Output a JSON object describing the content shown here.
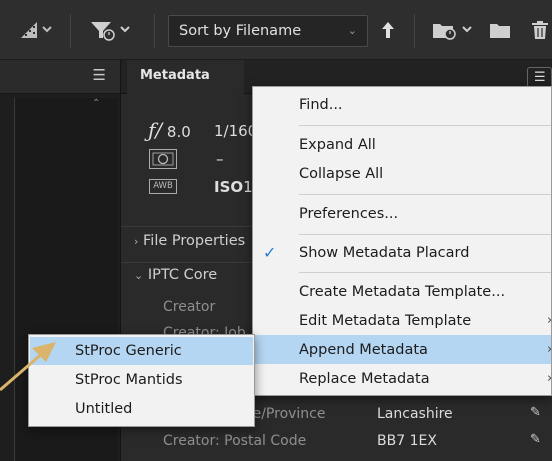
{
  "toolbar": {
    "sort_label": "Sort by Filename"
  },
  "panel": {
    "tab_label": "Metadata"
  },
  "placard": {
    "aperture_symbol": "ƒ/",
    "aperture": "8.0",
    "shutter": "1/160",
    "metering": "–",
    "wb_icon": "AWB",
    "iso_label": "ISO",
    "iso_value": "1"
  },
  "sections": {
    "file_properties": "File Properties",
    "iptc_core": "IPTC Core"
  },
  "fields": {
    "creator_label": "Creator",
    "creator_job_label": "Creator: Job",
    "state_label": "Creator: State/Province",
    "state_value": "Lancashire",
    "postal_label": "Creator: Postal Code",
    "postal_value": "BB7 1EX"
  },
  "context_menu": {
    "find": "Find...",
    "expand_all": "Expand All",
    "collapse_all": "Collapse All",
    "preferences": "Preferences...",
    "show_placard": "Show Metadata Placard",
    "create_template": "Create Metadata Template...",
    "edit_template": "Edit Metadata Template",
    "append": "Append Metadata",
    "replace": "Replace Metadata"
  },
  "submenu": {
    "items": [
      "StProc Generic",
      "StProc Mantids",
      "Untitled"
    ]
  },
  "colors": {
    "highlight": "#b5d6f2",
    "check": "#2a7bd6",
    "arrow": "#d9b46a"
  }
}
